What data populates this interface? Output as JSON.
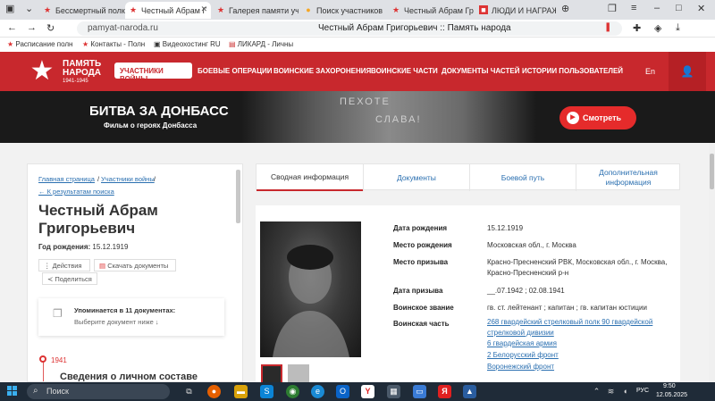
{
  "browser": {
    "tabs": [
      {
        "label": "Бессмертный полк",
        "icon": "star-icon"
      },
      {
        "label": "Честный Абрам Г",
        "icon": "star-icon",
        "active": true
      },
      {
        "label": "Галерея памяти уч",
        "icon": "star-icon"
      },
      {
        "label": "Поиск участников",
        "icon": "pin-icon"
      },
      {
        "label": "Честный Абрам Гри",
        "icon": "star-icon"
      },
      {
        "label": "ЛЮДИ И НАГРАЖД",
        "icon": "square-icon"
      }
    ],
    "url": "pamyat-naroda.ru",
    "page_title": "Честный Абрам Григорьевич :: Память народа",
    "bookmarks": [
      "Расписание полн",
      "Контакты - Полн",
      "Видеохостинг RU",
      "ЛИКАРД - Личны"
    ]
  },
  "site": {
    "logo": {
      "line1": "ПАМЯТЬ",
      "line2": "НАРОДА",
      "years": "1941-1945"
    },
    "nav": [
      "УЧАСТНИКИ ВОЙНЫ",
      "БОЕВЫЕ ОПЕРАЦИИ",
      "ВОИНСКИЕ ЗАХОРОНЕНИЯ",
      "ВОИНСКИЕ ЧАСТИ",
      "ДОКУМЕНТЫ ЧАСТЕЙ",
      "ИСТОРИИ ПОЛЬЗОВАТЕЛЕЙ"
    ],
    "lang": "En"
  },
  "banner": {
    "title": "БИТВА ЗА ДОНБАСС",
    "subtitle": "Фильм о героях Донбасса",
    "art_text1": "ПЕХОТЕ",
    "art_text2": "СЛАВА!",
    "button": "Смотреть"
  },
  "left": {
    "crumb_home": "Главная страница",
    "crumb_section": "Участники войны",
    "crumb_back": "← К результатам поиска",
    "name": "Честный Абрам Григорьевич",
    "birth_label": "Год рождения:",
    "birth_value": "15.12.1919",
    "actions": [
      "Действия",
      "Скачать документы",
      "Поделиться"
    ],
    "docs_title": "Упоминается в 11 документах:",
    "docs_hint": "Выберите документ ниже ↓",
    "timeline_year": "1941",
    "timeline_title": "Сведения о личном составе"
  },
  "tabs": [
    "Сводная информация",
    "Документы",
    "Боевой путь",
    "Дополнительная информация"
  ],
  "info": {
    "birth_date_label": "Дата рождения",
    "birth_date": "15.12.1919",
    "birth_place_label": "Место рождения",
    "birth_place": "Московская обл., г. Москва",
    "draft_place_label": "Место призыва",
    "draft_place": "Красно-Пресненский РВК, Московская обл., г. Москва, Красно-Пресненский р-н",
    "draft_date_label": "Дата призыва",
    "draft_date": "__.07.1942 ; 02.08.1941",
    "rank_label": "Воинское звание",
    "rank": "гв. ст. лейтенант ; капитан ; гв. капитан юстиции",
    "unit_label": "Воинская часть",
    "units": [
      "268 гвардейский стрелковый полк 90 гвардейской стрелковой дивизии",
      "6 гвардейская армия",
      "2 Белорусский фронт",
      "Воронежский фронт"
    ]
  },
  "taskbar": {
    "search": "Поиск",
    "lang": "РУС",
    "time": "9:50",
    "date": "12.05.2025"
  }
}
